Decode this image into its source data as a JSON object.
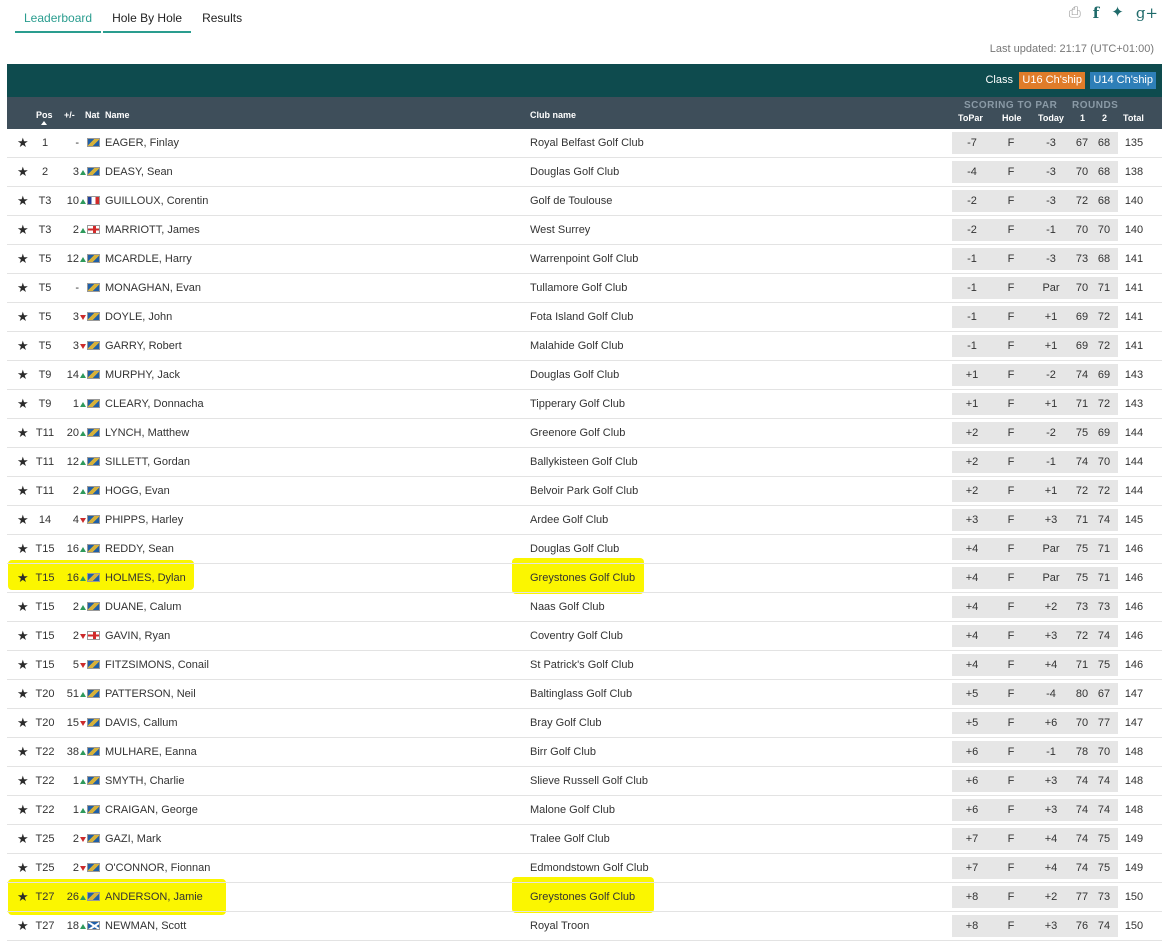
{
  "tabs": [
    {
      "label": "Leaderboard",
      "active": true
    },
    {
      "label": "Hole By Hole",
      "active": false
    },
    {
      "label": "Results",
      "active": false
    }
  ],
  "social": {
    "gplus_label": "g+"
  },
  "last_updated": "Last updated: 21:17 (UTC+01:00)",
  "class_bar": {
    "label": "Class",
    "u16": "U16 Ch'ship",
    "u14": "U14 Ch'ship",
    "u16_color": "#e07c29",
    "u14_color": "#2e7fb8"
  },
  "columns": {
    "pos": "Pos",
    "move": "+/-",
    "nat": "Nat",
    "name": "Name",
    "club": "Club name",
    "scoring_group": "SCORING TO PAR",
    "rounds_group": "ROUNDS",
    "topar": "ToPar",
    "hole": "Hole",
    "today": "Today",
    "r1": "1",
    "r2": "2",
    "total": "Total"
  },
  "highlight_color": "#fbf600",
  "rows": [
    {
      "pos": "1",
      "mv": "-",
      "dir": "",
      "nat": "irl",
      "name": "EAGER, Finlay",
      "club": "Royal Belfast Golf Club",
      "topar": "-7",
      "hole": "F",
      "today": "-3",
      "r1": "67",
      "r2": "68",
      "total": "135",
      "hl": false
    },
    {
      "pos": "2",
      "mv": "3",
      "dir": "up",
      "nat": "irl",
      "name": "DEASY, Sean",
      "club": "Douglas Golf Club",
      "topar": "-4",
      "hole": "F",
      "today": "-3",
      "r1": "70",
      "r2": "68",
      "total": "138",
      "hl": false
    },
    {
      "pos": "T3",
      "mv": "10",
      "dir": "up",
      "nat": "fra",
      "name": "GUILLOUX, Corentin",
      "club": "Golf de Toulouse",
      "topar": "-2",
      "hole": "F",
      "today": "-3",
      "r1": "72",
      "r2": "68",
      "total": "140",
      "hl": false
    },
    {
      "pos": "T3",
      "mv": "2",
      "dir": "up",
      "nat": "eng",
      "name": "MARRIOTT, James",
      "club": "West Surrey",
      "topar": "-2",
      "hole": "F",
      "today": "-1",
      "r1": "70",
      "r2": "70",
      "total": "140",
      "hl": false
    },
    {
      "pos": "T5",
      "mv": "12",
      "dir": "up",
      "nat": "irl",
      "name": "MCARDLE, Harry",
      "club": "Warrenpoint Golf Club",
      "topar": "-1",
      "hole": "F",
      "today": "-3",
      "r1": "73",
      "r2": "68",
      "total": "141",
      "hl": false
    },
    {
      "pos": "T5",
      "mv": "-",
      "dir": "",
      "nat": "irl",
      "name": "MONAGHAN, Evan",
      "club": "Tullamore Golf Club",
      "topar": "-1",
      "hole": "F",
      "today": "Par",
      "r1": "70",
      "r2": "71",
      "total": "141",
      "hl": false
    },
    {
      "pos": "T5",
      "mv": "3",
      "dir": "down",
      "nat": "irl",
      "name": "DOYLE, John",
      "club": "Fota Island Golf Club",
      "topar": "-1",
      "hole": "F",
      "today": "+1",
      "r1": "69",
      "r2": "72",
      "total": "141",
      "hl": false
    },
    {
      "pos": "T5",
      "mv": "3",
      "dir": "down",
      "nat": "irl",
      "name": "GARRY, Robert",
      "club": "Malahide Golf Club",
      "topar": "-1",
      "hole": "F",
      "today": "+1",
      "r1": "69",
      "r2": "72",
      "total": "141",
      "hl": false
    },
    {
      "pos": "T9",
      "mv": "14",
      "dir": "up",
      "nat": "irl",
      "name": "MURPHY, Jack",
      "club": "Douglas Golf Club",
      "topar": "+1",
      "hole": "F",
      "today": "-2",
      "r1": "74",
      "r2": "69",
      "total": "143",
      "hl": false
    },
    {
      "pos": "T9",
      "mv": "1",
      "dir": "up",
      "nat": "irl",
      "name": "CLEARY, Donnacha",
      "club": "Tipperary Golf Club",
      "topar": "+1",
      "hole": "F",
      "today": "+1",
      "r1": "71",
      "r2": "72",
      "total": "143",
      "hl": false
    },
    {
      "pos": "T11",
      "mv": "20",
      "dir": "up",
      "nat": "irl",
      "name": "LYNCH, Matthew",
      "club": "Greenore Golf Club",
      "topar": "+2",
      "hole": "F",
      "today": "-2",
      "r1": "75",
      "r2": "69",
      "total": "144",
      "hl": false
    },
    {
      "pos": "T11",
      "mv": "12",
      "dir": "up",
      "nat": "irl",
      "name": "SILLETT, Gordan",
      "club": "Ballykisteen Golf Club",
      "topar": "+2",
      "hole": "F",
      "today": "-1",
      "r1": "74",
      "r2": "70",
      "total": "144",
      "hl": false
    },
    {
      "pos": "T11",
      "mv": "2",
      "dir": "up",
      "nat": "irl",
      "name": "HOGG, Evan",
      "club": "Belvoir Park Golf Club",
      "topar": "+2",
      "hole": "F",
      "today": "+1",
      "r1": "72",
      "r2": "72",
      "total": "144",
      "hl": false
    },
    {
      "pos": "14",
      "mv": "4",
      "dir": "down",
      "nat": "irl",
      "name": "PHIPPS, Harley",
      "club": "Ardee Golf Club",
      "topar": "+3",
      "hole": "F",
      "today": "+3",
      "r1": "71",
      "r2": "74",
      "total": "145",
      "hl": false
    },
    {
      "pos": "T15",
      "mv": "16",
      "dir": "up",
      "nat": "irl",
      "name": "REDDY, Sean",
      "club": "Douglas Golf Club",
      "topar": "+4",
      "hole": "F",
      "today": "Par",
      "r1": "75",
      "r2": "71",
      "total": "146",
      "hl": false
    },
    {
      "pos": "T15",
      "mv": "16",
      "dir": "up",
      "nat": "irl",
      "name": "HOLMES, Dylan",
      "club": "Greystones Golf Club",
      "topar": "+4",
      "hole": "F",
      "today": "Par",
      "r1": "75",
      "r2": "71",
      "total": "146",
      "hl": true
    },
    {
      "pos": "T15",
      "mv": "2",
      "dir": "up",
      "nat": "irl",
      "name": "DUANE, Calum",
      "club": "Naas Golf Club",
      "topar": "+4",
      "hole": "F",
      "today": "+2",
      "r1": "73",
      "r2": "73",
      "total": "146",
      "hl": false
    },
    {
      "pos": "T15",
      "mv": "2",
      "dir": "down",
      "nat": "eng",
      "name": "GAVIN, Ryan",
      "club": "Coventry Golf Club",
      "topar": "+4",
      "hole": "F",
      "today": "+3",
      "r1": "72",
      "r2": "74",
      "total": "146",
      "hl": false
    },
    {
      "pos": "T15",
      "mv": "5",
      "dir": "down",
      "nat": "irl",
      "name": "FITZSIMONS, Conail",
      "club": "St Patrick's Golf Club",
      "topar": "+4",
      "hole": "F",
      "today": "+4",
      "r1": "71",
      "r2": "75",
      "total": "146",
      "hl": false
    },
    {
      "pos": "T20",
      "mv": "51",
      "dir": "up",
      "nat": "irl",
      "name": "PATTERSON, Neil",
      "club": "Baltinglass Golf Club",
      "topar": "+5",
      "hole": "F",
      "today": "-4",
      "r1": "80",
      "r2": "67",
      "total": "147",
      "hl": false
    },
    {
      "pos": "T20",
      "mv": "15",
      "dir": "down",
      "nat": "irl",
      "name": "DAVIS, Callum",
      "club": "Bray Golf Club",
      "topar": "+5",
      "hole": "F",
      "today": "+6",
      "r1": "70",
      "r2": "77",
      "total": "147",
      "hl": false
    },
    {
      "pos": "T22",
      "mv": "38",
      "dir": "up",
      "nat": "irl",
      "name": "MULHARE, Eanna",
      "club": "Birr Golf Club",
      "topar": "+6",
      "hole": "F",
      "today": "-1",
      "r1": "78",
      "r2": "70",
      "total": "148",
      "hl": false
    },
    {
      "pos": "T22",
      "mv": "1",
      "dir": "up",
      "nat": "irl",
      "name": "SMYTH, Charlie",
      "club": "Slieve Russell Golf Club",
      "topar": "+6",
      "hole": "F",
      "today": "+3",
      "r1": "74",
      "r2": "74",
      "total": "148",
      "hl": false
    },
    {
      "pos": "T22",
      "mv": "1",
      "dir": "up",
      "nat": "irl",
      "name": "CRAIGAN, George",
      "club": "Malone Golf Club",
      "topar": "+6",
      "hole": "F",
      "today": "+3",
      "r1": "74",
      "r2": "74",
      "total": "148",
      "hl": false
    },
    {
      "pos": "T25",
      "mv": "2",
      "dir": "down",
      "nat": "irl",
      "name": "GAZI, Mark",
      "club": "Tralee Golf Club",
      "topar": "+7",
      "hole": "F",
      "today": "+4",
      "r1": "74",
      "r2": "75",
      "total": "149",
      "hl": false
    },
    {
      "pos": "T25",
      "mv": "2",
      "dir": "down",
      "nat": "irl",
      "name": "O'CONNOR, Fionnan",
      "club": "Edmondstown Golf Club",
      "topar": "+7",
      "hole": "F",
      "today": "+4",
      "r1": "74",
      "r2": "75",
      "total": "149",
      "hl": false
    },
    {
      "pos": "T27",
      "mv": "26",
      "dir": "up",
      "nat": "irl",
      "name": "ANDERSON, Jamie",
      "club": "Greystones Golf Club",
      "topar": "+8",
      "hole": "F",
      "today": "+2",
      "r1": "77",
      "r2": "73",
      "total": "150",
      "hl": true
    },
    {
      "pos": "T27",
      "mv": "18",
      "dir": "up",
      "nat": "sco",
      "name": "NEWMAN, Scott",
      "club": "Royal Troon",
      "topar": "+8",
      "hole": "F",
      "today": "+3",
      "r1": "76",
      "r2": "74",
      "total": "150",
      "hl": false
    }
  ]
}
